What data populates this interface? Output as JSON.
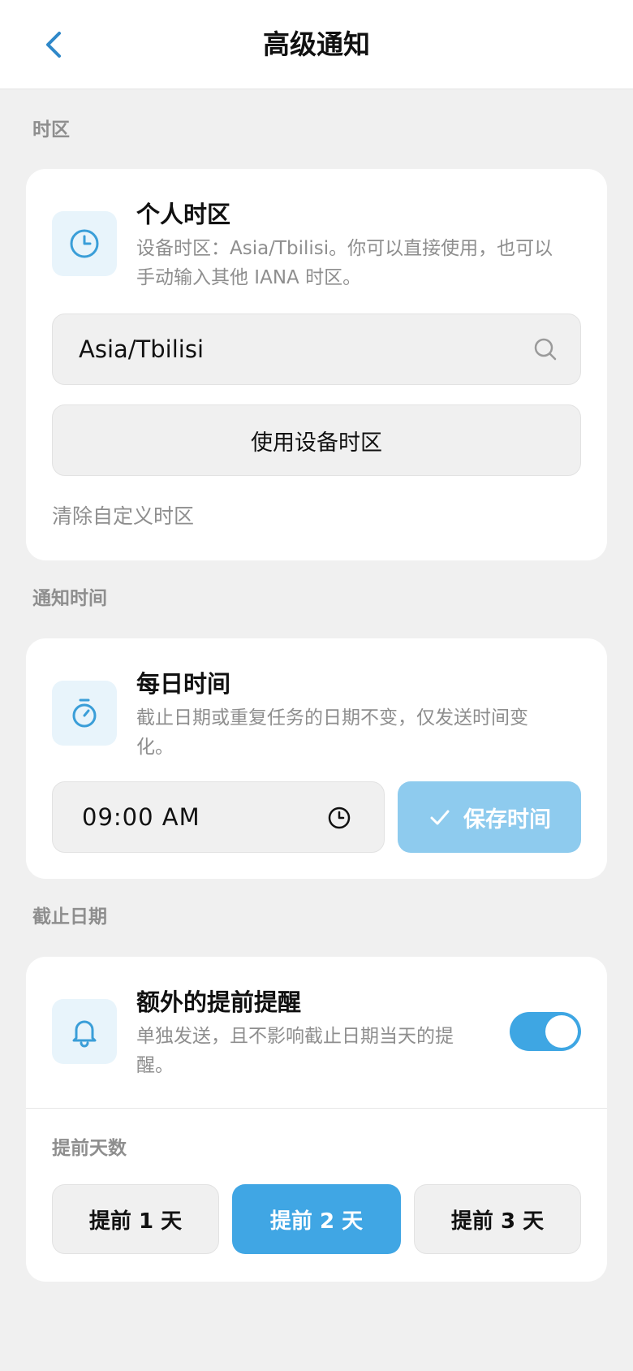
{
  "header": {
    "title": "高级通知",
    "back_icon": "chevron-left-icon",
    "accent_color": "#2f88c9"
  },
  "timezone_section": {
    "label": "时区",
    "card": {
      "icon": "clock-icon",
      "title": "个人时区",
      "description_line1": "设备时区：Asia/Tbilisi。你可以直接使用，也可以",
      "description_line2": "手动输入其他 IANA 时区。",
      "input_value": "Asia/Tbilisi",
      "search_icon": "search-icon",
      "use_device_button": "使用设备时区",
      "clear_link": "清除自定义时区"
    }
  },
  "notify_time_section": {
    "label": "通知时间",
    "card": {
      "icon": "stopwatch-icon",
      "title": "每日时间",
      "description_line1": "截止日期或重复任务的日期不变，仅发送时间变",
      "description_line2": "化。",
      "time_value": "09:00 AM",
      "time_icon": "clock-icon",
      "save_button": "保存时间",
      "save_icon": "check-icon",
      "save_button_color": "#8ecbee"
    }
  },
  "due_date_section": {
    "label": "截止日期",
    "card": {
      "icon": "bell-icon",
      "title": "额外的提前提醒",
      "description_line1": "单独发送，且不影响截止日期当天的提",
      "description_line2": "醒。",
      "toggle_on": true,
      "toggle_color": "#3ea6e3",
      "days_label": "提前天数",
      "options": [
        "提前 1 天",
        "提前 2 天",
        "提前 3 天"
      ],
      "selected_index": 1,
      "selected_color": "#40a6e4"
    }
  }
}
